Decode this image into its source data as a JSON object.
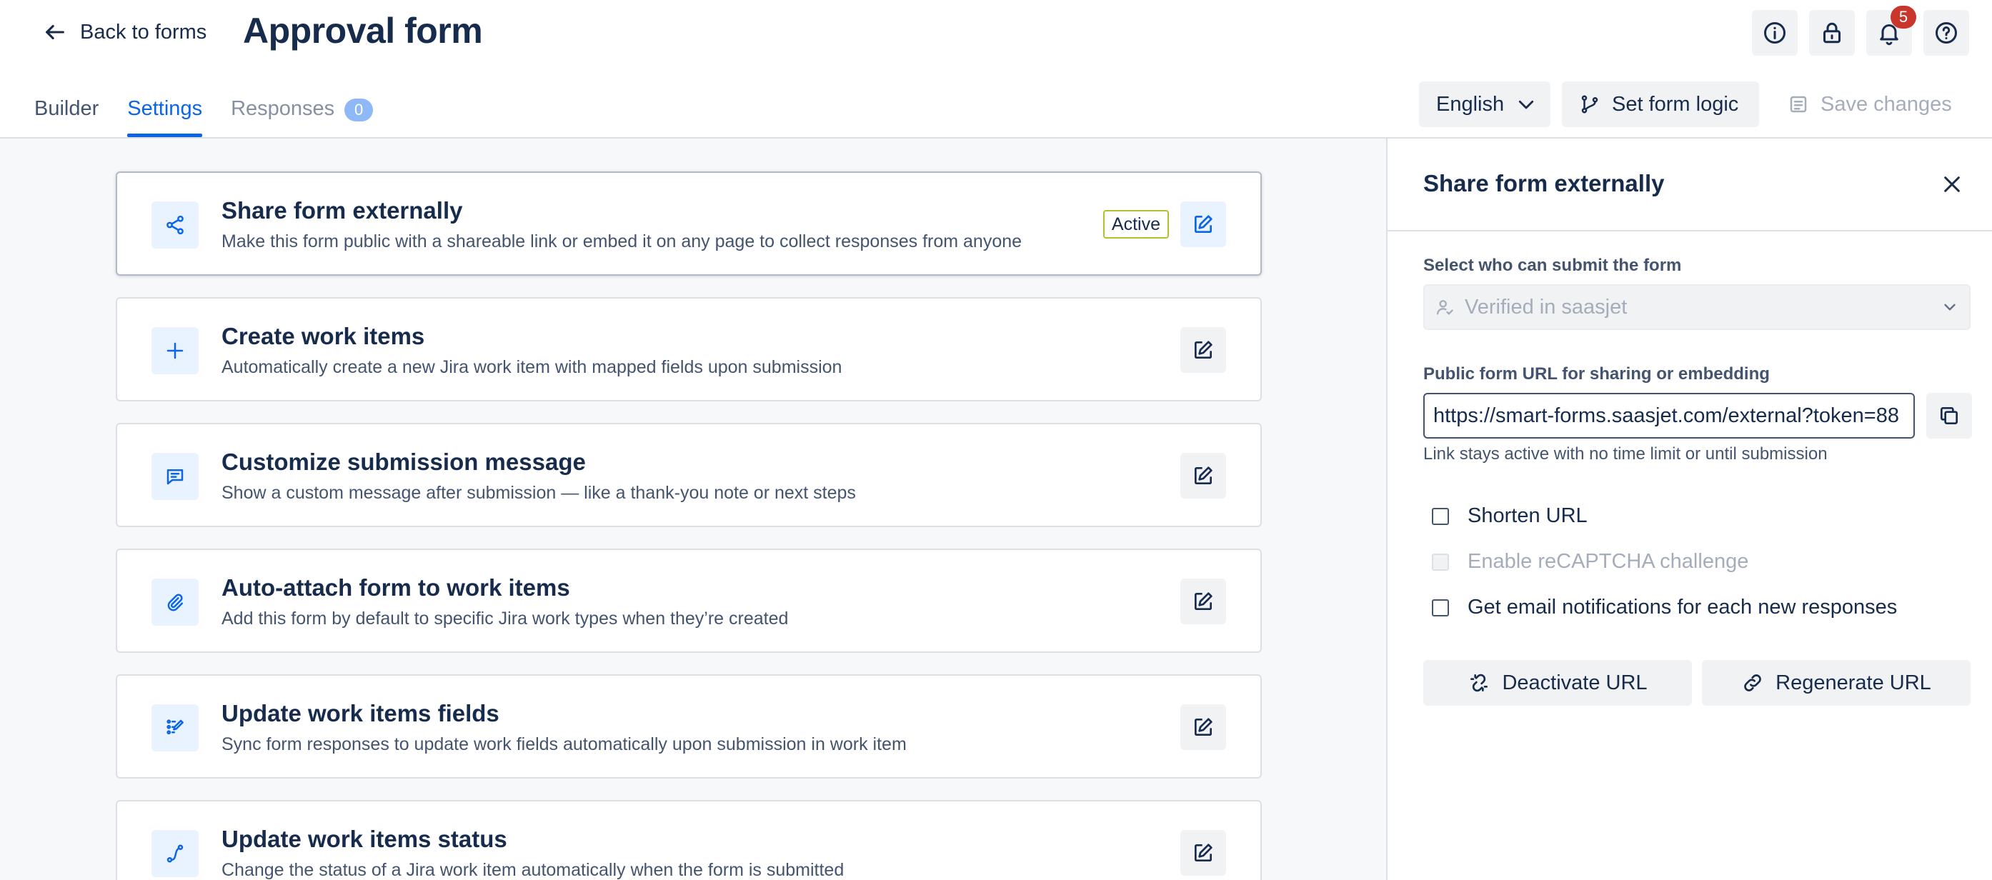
{
  "header": {
    "back_label": "Back to forms",
    "title": "Approval form",
    "notifications_count": "5",
    "icons": [
      "info-icon",
      "lock-icon",
      "bell-icon",
      "help-icon"
    ]
  },
  "tabs": [
    {
      "label": "Builder"
    },
    {
      "label": "Settings"
    },
    {
      "label": "Responses",
      "count": "0"
    }
  ],
  "toolbar": {
    "language": "English",
    "form_logic_label": "Set form logic",
    "save_label": "Save changes"
  },
  "cards": [
    {
      "icon": "share-icon",
      "title": "Share form externally",
      "description": "Make this form public with a shareable link or embed it on any page to collect responses from anyone",
      "status": "Active"
    },
    {
      "icon": "plus-icon",
      "title": "Create work items",
      "description": "Automatically create a new Jira work item with mapped fields upon submission"
    },
    {
      "icon": "message-icon",
      "title": "Customize submission message",
      "description": "Show a custom message after submission — like a thank-you note or next steps"
    },
    {
      "icon": "paperclip-icon",
      "title": "Auto-attach form to work items",
      "description": "Add this form by default to specific Jira work types when they’re created"
    },
    {
      "icon": "list-edit-icon",
      "title": "Update work items fields",
      "description": "Sync form responses to update work fields automatically upon submission in work item"
    },
    {
      "icon": "route-icon",
      "title": "Update work items status",
      "description": "Change the status of a Jira work item automatically when the form is submitted"
    }
  ],
  "panel": {
    "title": "Share form externally",
    "who_label": "Select who can submit the form",
    "who_value": "Verified in saasjet",
    "url_label": "Public form URL for sharing or embedding",
    "url_value": "https://smart-forms.saasjet.com/external?token=88",
    "helper": "Link stays active with no time limit or until submission",
    "options": [
      {
        "label": "Shorten URL",
        "disabled": false
      },
      {
        "label": "Enable reCAPTCHA challenge",
        "disabled": true
      },
      {
        "label": "Get email notifications for each new responses",
        "disabled": false
      }
    ],
    "deactivate_label": "Deactivate URL",
    "regenerate_label": "Regenerate URL"
  },
  "colors": {
    "accent": "#0c66e4",
    "badge": "#c9372c",
    "active_border": "#b3bf2b"
  }
}
